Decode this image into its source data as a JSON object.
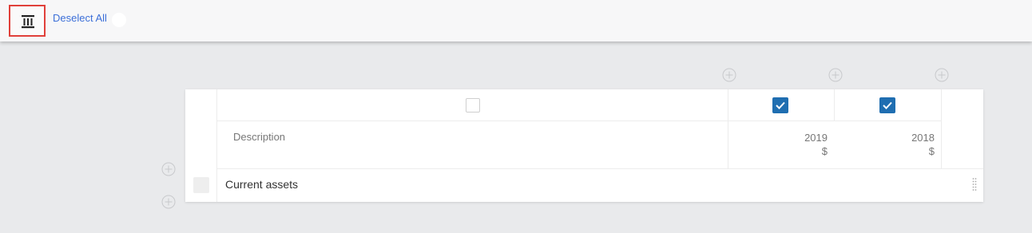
{
  "toolbar": {
    "icon": "statement-columns-icon",
    "deselect_label": "Deselect All"
  },
  "table": {
    "column_checkboxes": [
      {
        "column": "description",
        "checked": false
      },
      {
        "column": "2019",
        "checked": true
      },
      {
        "column": "2018",
        "checked": true
      }
    ],
    "headers": {
      "description": "Description",
      "col1_year": "2019",
      "col1_unit": "$",
      "col2_year": "2018",
      "col2_unit": "$"
    },
    "rows": [
      {
        "label": "Current assets"
      }
    ]
  },
  "colors": {
    "accent_checkbox": "#1f6eb1",
    "link": "#3c6fd8",
    "highlight_border": "#e0403a"
  }
}
